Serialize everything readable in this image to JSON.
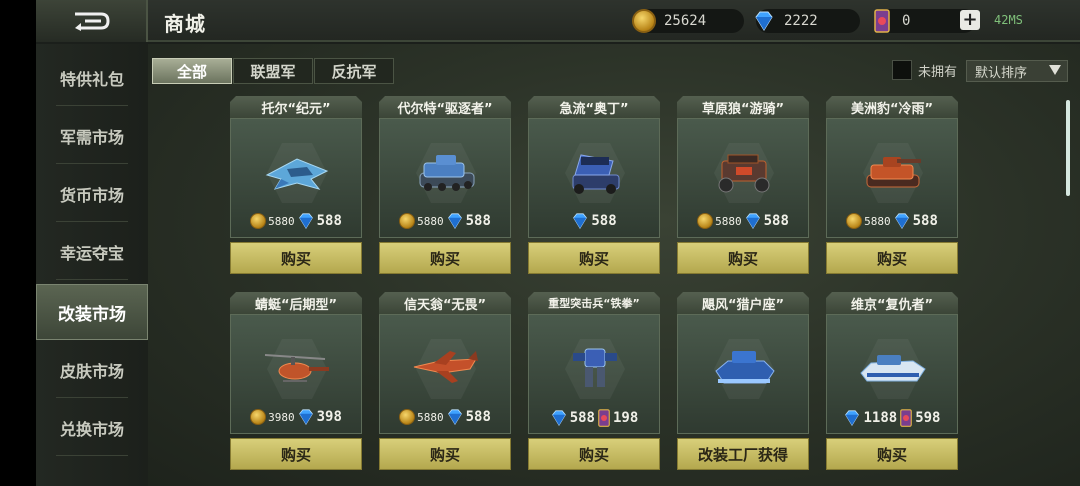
{
  "topbar": {
    "title": "商城",
    "gold": "25624",
    "gems": "2222",
    "cards": "0",
    "ping": "42MS"
  },
  "sidebar": {
    "items": [
      {
        "label": "特供礼包"
      },
      {
        "label": "军需市场"
      },
      {
        "label": "货币市场"
      },
      {
        "label": "幸运夺宝"
      },
      {
        "label": "改装市场",
        "active": true
      },
      {
        "label": "皮肤市场"
      },
      {
        "label": "兑换市场"
      }
    ]
  },
  "tabs": [
    {
      "label": "全部",
      "active": true
    },
    {
      "label": "联盟军"
    },
    {
      "label": "反抗军"
    }
  ],
  "filter": {
    "label": "未拥有"
  },
  "sort": {
    "label": "默认排序"
  },
  "cards": [
    {
      "name": "托尔“纪元”",
      "gold": "5880",
      "gem": "588",
      "buy": "购买",
      "vehicle": "jet-icon"
    },
    {
      "name": "代尔特“驱逐者”",
      "gold": "5880",
      "gem": "588",
      "buy": "购买",
      "vehicle": "tank-icon"
    },
    {
      "name": "急流“奥丁”",
      "gem": "588",
      "buy": "购买",
      "vehicle": "launcher-icon"
    },
    {
      "name": "草原狼“游骑”",
      "gold": "5880",
      "gem": "588",
      "buy": "购买",
      "vehicle": "buggy-icon"
    },
    {
      "name": "美洲豹“冷雨”",
      "gold": "5880",
      "gem": "588",
      "buy": "购买",
      "vehicle": "tank-icon"
    },
    {
      "name": "蜻蜓“后期型”",
      "gold": "3980",
      "gem": "398",
      "buy": "购买",
      "vehicle": "helicopter-icon"
    },
    {
      "name": "信天翁“无畏”",
      "gold": "5880",
      "gem": "588",
      "buy": "购买",
      "vehicle": "plane-icon"
    },
    {
      "name": "重型突击兵“铁拳”",
      "gem": "588",
      "card": "198",
      "buy": "购买",
      "vehicle": "mech-icon"
    },
    {
      "name": "飓风“猎户座”",
      "buy": "改装工厂获得",
      "vehicle": "hover-tank-icon"
    },
    {
      "name": "维京“复仇者”",
      "gem": "1188",
      "card": "598",
      "buy": "购买",
      "vehicle": "boat-icon"
    }
  ],
  "colors": {
    "buy_button": "#c9bf66",
    "gold": "#d6a52c",
    "gem": "#3fa2ff",
    "card": "#b93b4a"
  }
}
